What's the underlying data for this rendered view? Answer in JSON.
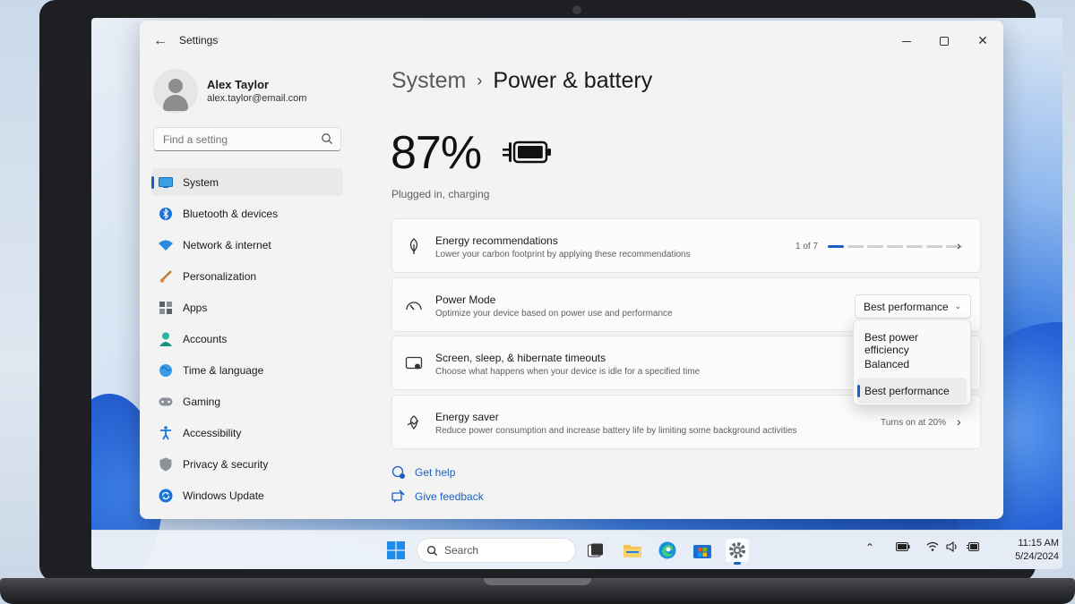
{
  "window": {
    "title": "Settings"
  },
  "profile": {
    "name": "Alex Taylor",
    "email": "alex.taylor@email.com"
  },
  "search": {
    "placeholder": "Find a setting"
  },
  "sidebar": {
    "items": [
      {
        "label": "System",
        "icon": "system-icon",
        "active": true
      },
      {
        "label": "Bluetooth & devices",
        "icon": "bluetooth-icon"
      },
      {
        "label": "Network & internet",
        "icon": "wifi-icon"
      },
      {
        "label": "Personalization",
        "icon": "brush-icon"
      },
      {
        "label": "Apps",
        "icon": "apps-icon"
      },
      {
        "label": "Accounts",
        "icon": "accounts-icon"
      },
      {
        "label": "Time & language",
        "icon": "globe-icon"
      },
      {
        "label": "Gaming",
        "icon": "gamepad-icon"
      },
      {
        "label": "Accessibility",
        "icon": "accessibility-icon"
      },
      {
        "label": "Privacy & security",
        "icon": "shield-icon"
      },
      {
        "label": "Windows Update",
        "icon": "update-icon"
      }
    ]
  },
  "header": {
    "parent": "System",
    "separator": "›",
    "title": "Power & battery"
  },
  "battery": {
    "percent": "87%",
    "status": "Plugged in, charging",
    "level": 0.87
  },
  "cards": {
    "energy_recommendations": {
      "title": "Energy recommendations",
      "subtitle": "Lower your carbon footprint by applying these recommendations",
      "pager": "1 of 7",
      "page_current": 1,
      "page_total": 7
    },
    "power_mode": {
      "title": "Power Mode",
      "subtitle": "Optimize your device based on power use and performance",
      "selected": "Best performance",
      "options": [
        "Best power efficiency",
        "Balanced",
        "Best performance"
      ]
    },
    "timeouts": {
      "title": "Screen, sleep, & hibernate timeouts",
      "subtitle": "Choose what happens when your device is idle for a specified time"
    },
    "energy_saver": {
      "title": "Energy saver",
      "subtitle": "Reduce power consumption and increase battery life by limiting some background activities",
      "value": "Turns on at 20%"
    }
  },
  "links": {
    "help": "Get help",
    "feedback": "Give feedback"
  },
  "taskbar": {
    "search_label": "Search",
    "time": "11:15 AM",
    "date": "5/24/2024"
  },
  "colors": {
    "accent": "#1a5fc4",
    "window_bg": "#f3f3f3",
    "card_bg": "#fbfbfb"
  }
}
